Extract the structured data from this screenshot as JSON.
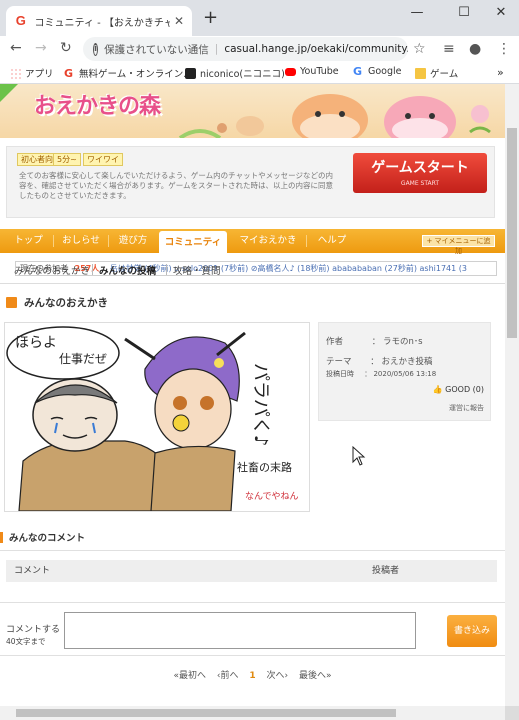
{
  "browser": {
    "tab_title": "コミュニティ - 【おえかきチャットゲーム",
    "tab_favicon": "G",
    "security_label": "保護されていない通信",
    "url": "casual.hange.jp/oekaki/community...",
    "bookmarks": [
      "アプリ",
      "無料ゲーム・オンライン...",
      "niconico(ニコニコ)",
      "YouTube",
      "Google",
      "ゲーム"
    ]
  },
  "site": {
    "logo_text": "おえかきの森",
    "badges": [
      "初心者向",
      "5分~",
      "ワイワイ"
    ],
    "notice": "全てのお客様に安心して楽しんでいただけるよう、ゲーム内のチャットやメッセージなどの内容を、確認させていただく場合があります。ゲームをスタートされた時は、以上の内容に同意したものとさせていただきます。",
    "game_start": "ゲームスタート",
    "game_start_sub": "GAME START",
    "players_label": "現在の参加者",
    "players_count": "257人",
    "players_ticker": "岳は甘党 (4秒前)  u.solo2001 (7秒前)  ⊘高橋名人♪ (18秒前)  ababababan (27秒前)  ashi1741 (3"
  },
  "menu": {
    "items": [
      "トップ",
      "おしらせ",
      "遊び方",
      "コミュニティ",
      "マイおえかき",
      "ヘルプ"
    ],
    "active": "コミュニティ",
    "mymenu": "+ マイメニューに追加"
  },
  "submenu": [
    "みんなのおえかき",
    "みんなの投稿",
    "攻略・質問"
  ],
  "section_title": "みんなのおえかき",
  "drawing_texts": [
    "ほらよ",
    "仕事だぜ",
    "パラパく♪",
    "社畜の末路",
    "なんでやねん"
  ],
  "detail": {
    "author_label": "作者",
    "author": "ラモのn･s",
    "theme_label": "テーマ",
    "theme": "おえかき投稿",
    "date_label": "投稿日時",
    "date": "2020/05/06 13:18",
    "good": "GOOD",
    "good_count": "(0)",
    "report": "運営に報告"
  },
  "comments": {
    "title": "みんなのコメント",
    "col_comment": "コメント",
    "col_author": "投稿者",
    "form_label": "コメントする",
    "form_limit": "40文字まで",
    "submit": "書き込み"
  },
  "pager": {
    "first": "«最初へ",
    "prev": "‹前へ",
    "current": "1",
    "next": "次へ›",
    "last": "最後へ»"
  },
  "colors": {
    "accent_orange": "#ee9a10",
    "game_start_red": "#d3271d",
    "logo_pink": "#e8508a"
  }
}
